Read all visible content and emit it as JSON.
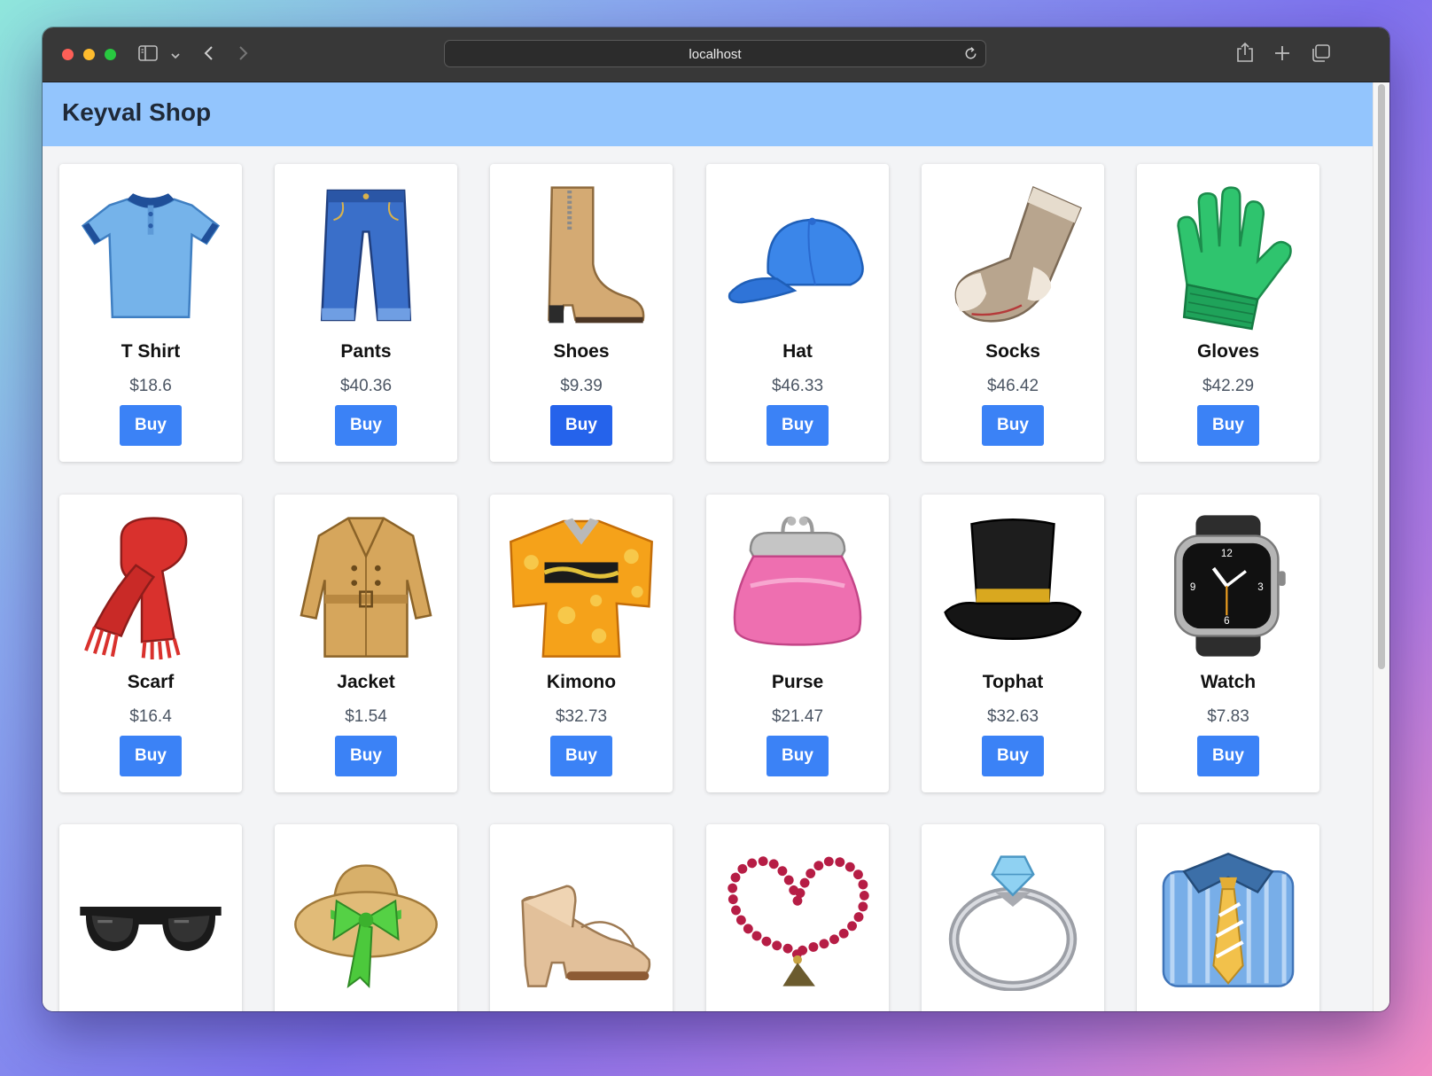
{
  "browser": {
    "url": "localhost"
  },
  "shop": {
    "title": "Keyval Shop"
  },
  "products": [
    {
      "name": "T Shirt",
      "price": "$18.6",
      "buy": "Buy",
      "icon": "t-shirt-icon"
    },
    {
      "name": "Pants",
      "price": "$40.36",
      "buy": "Buy",
      "icon": "jeans-icon"
    },
    {
      "name": "Shoes",
      "price": "$9.39",
      "buy": "Buy",
      "icon": "boot-icon"
    },
    {
      "name": "Hat",
      "price": "$46.33",
      "buy": "Buy",
      "icon": "cap-icon"
    },
    {
      "name": "Socks",
      "price": "$46.42",
      "buy": "Buy",
      "icon": "sock-icon"
    },
    {
      "name": "Gloves",
      "price": "$42.29",
      "buy": "Buy",
      "icon": "gloves-icon"
    },
    {
      "name": "Scarf",
      "price": "$16.4",
      "buy": "Buy",
      "icon": "scarf-icon"
    },
    {
      "name": "Jacket",
      "price": "$1.54",
      "buy": "Buy",
      "icon": "coat-icon"
    },
    {
      "name": "Kimono",
      "price": "$32.73",
      "buy": "Buy",
      "icon": "kimono-icon"
    },
    {
      "name": "Purse",
      "price": "$21.47",
      "buy": "Buy",
      "icon": "purse-icon"
    },
    {
      "name": "Tophat",
      "price": "$32.63",
      "buy": "Buy",
      "icon": "tophat-icon"
    },
    {
      "name": "Watch",
      "price": "$7.83",
      "buy": "Buy",
      "icon": "watch-icon"
    },
    {
      "name": "",
      "price": "",
      "buy": "",
      "icon": "sunglasses-icon"
    },
    {
      "name": "",
      "price": "",
      "buy": "",
      "icon": "sun-hat-icon"
    },
    {
      "name": "",
      "price": "",
      "buy": "",
      "icon": "high-heel-icon"
    },
    {
      "name": "",
      "price": "",
      "buy": "",
      "icon": "prayer-beads-icon"
    },
    {
      "name": "",
      "price": "",
      "buy": "",
      "icon": "ring-icon"
    },
    {
      "name": "",
      "price": "",
      "buy": "",
      "icon": "shirt-tie-icon"
    }
  ],
  "colors": {
    "header_bg": "#93c5fd",
    "button": "#3b82f6",
    "button_hover": "#2563eb",
    "page_bg": "#f3f4f6"
  }
}
